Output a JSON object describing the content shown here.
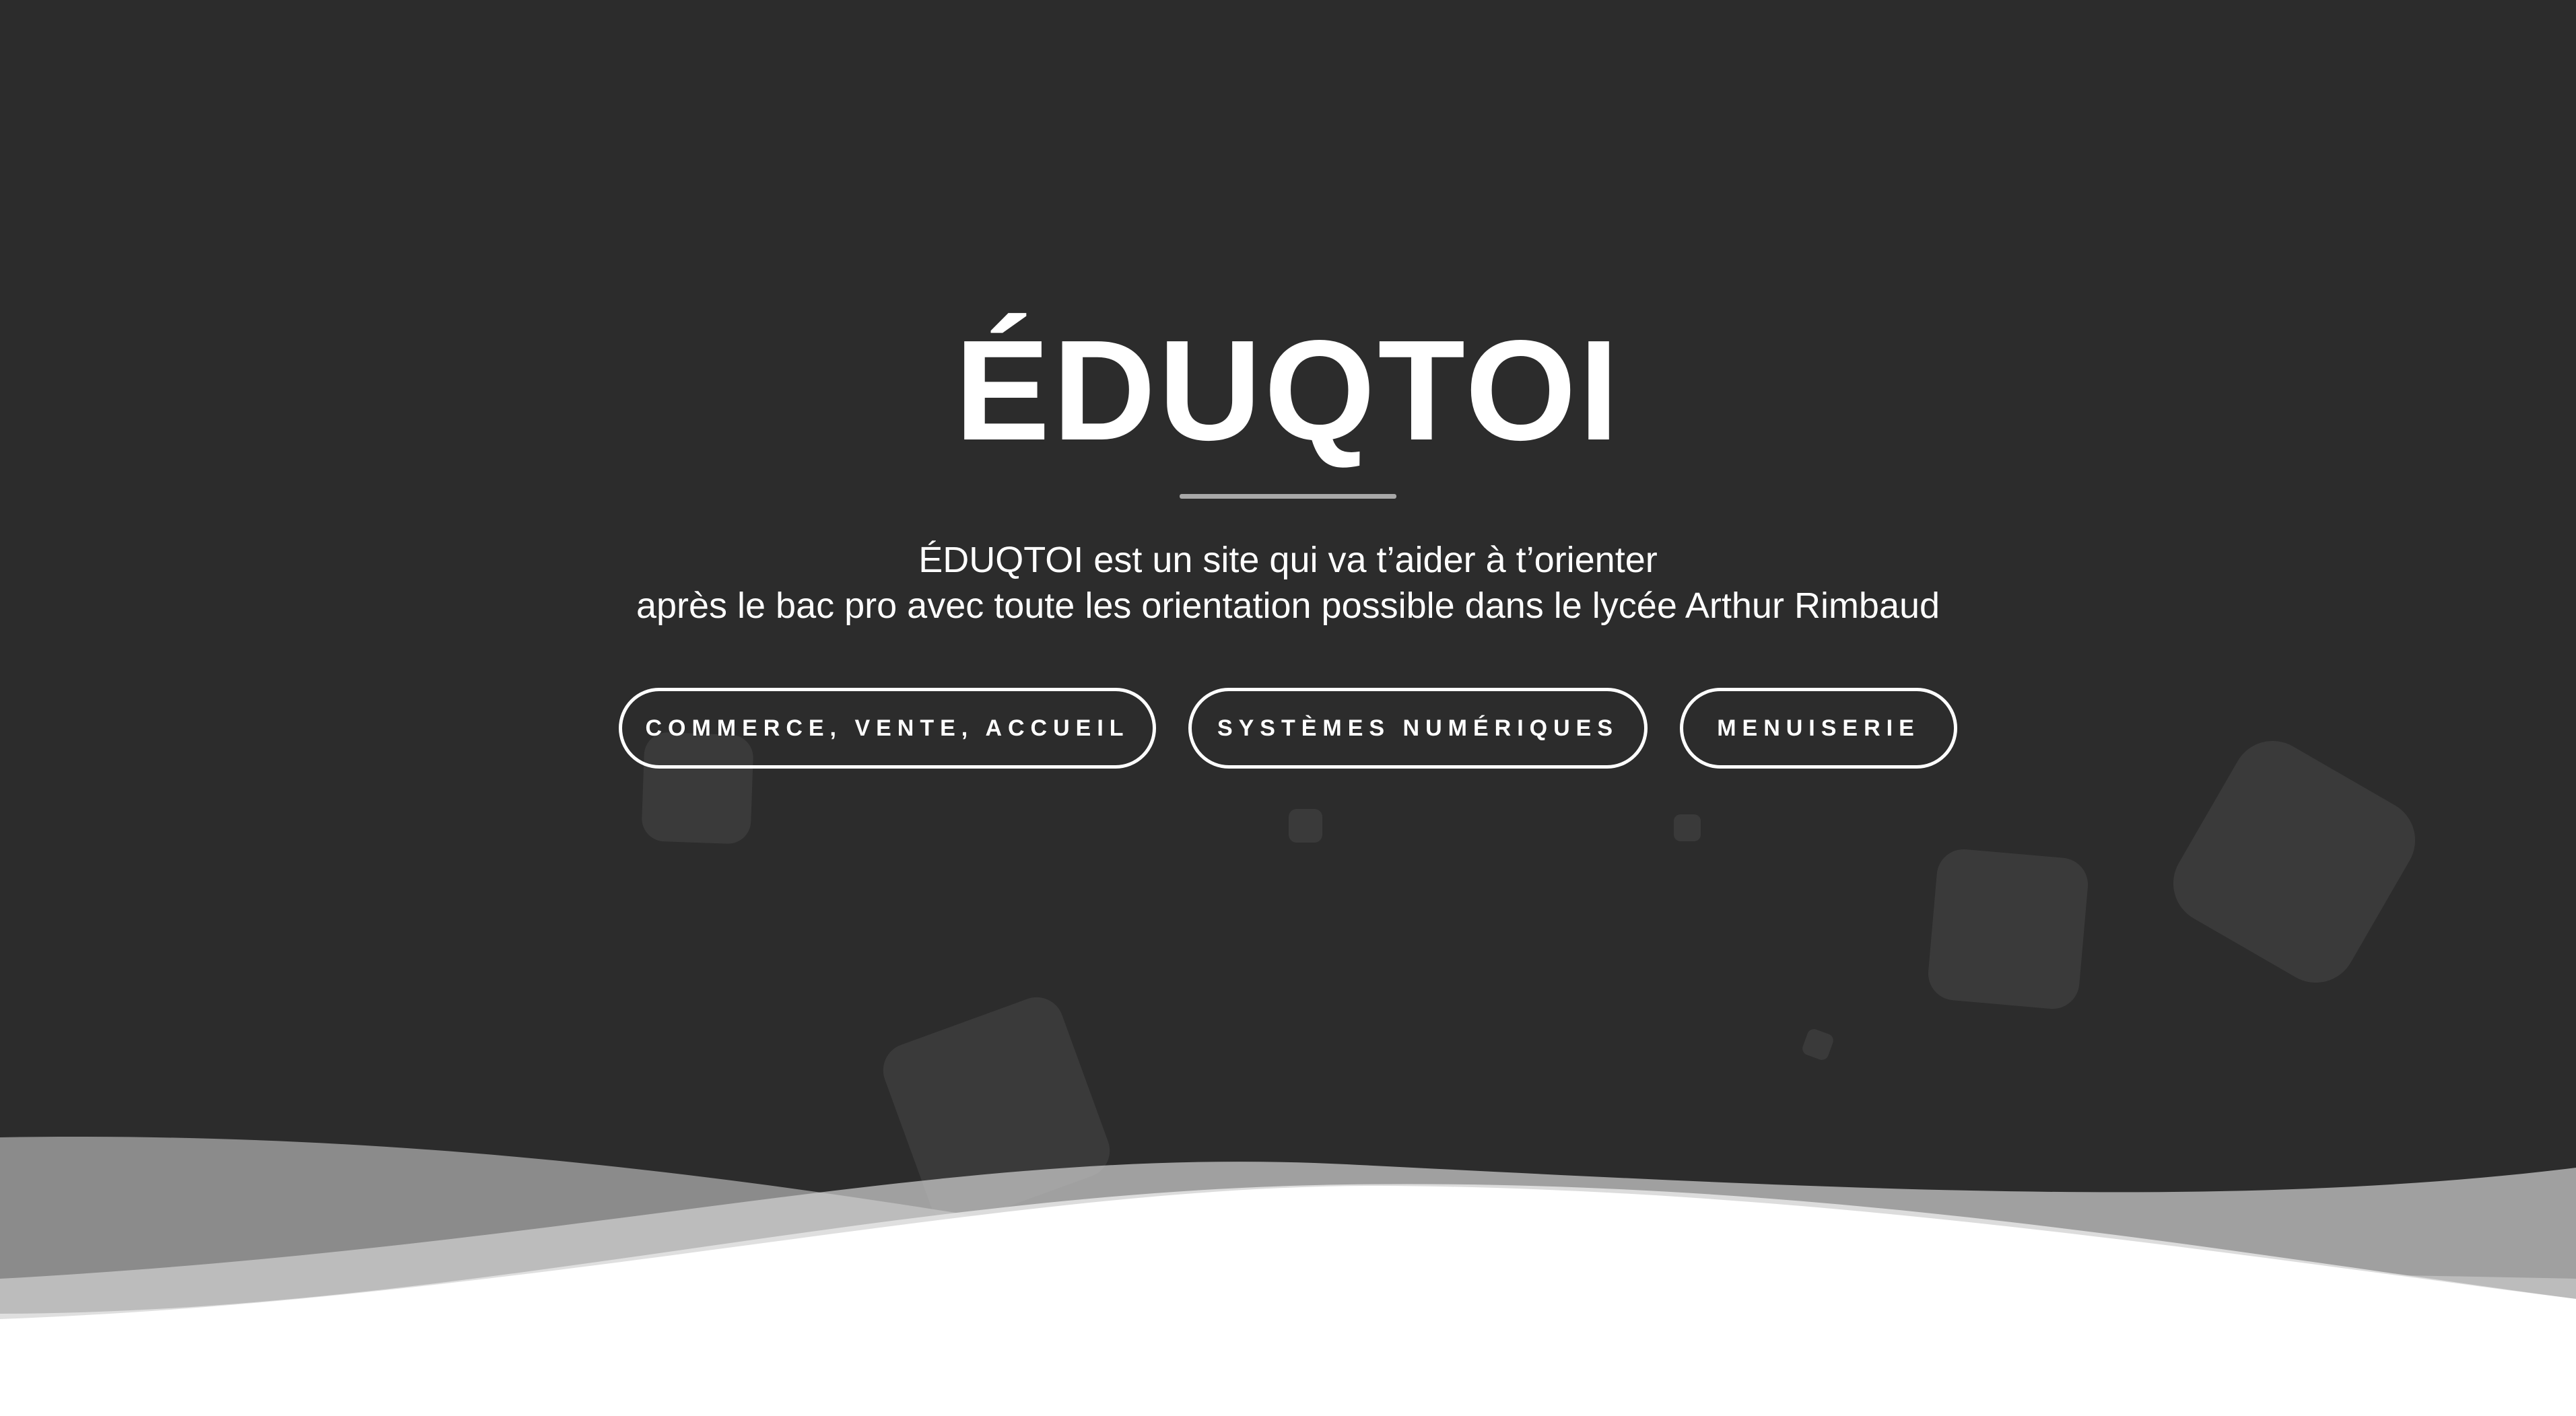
{
  "hero": {
    "title": "ÉDUQTOI",
    "subtitle_line1": "ÉDUQTOI est un site qui va t’aider à t’orienter",
    "subtitle_line2": "après le bac pro avec toute les orientation possible dans le lycée Arthur Rimbaud"
  },
  "nav": {
    "buttons": [
      {
        "label": "COMMERCE, VENTE, ACCUEIL"
      },
      {
        "label": "SYSTÈMES NUMÉRIQUES"
      },
      {
        "label": "MENUISERIE"
      }
    ]
  },
  "colors": {
    "background": "#2c2c2c",
    "text": "#ffffff",
    "divider": "#a9a9a9",
    "wave_light": "#d0d0d0",
    "wave_mid": "#9a9a9a",
    "wave_dark": "#6f6f6f"
  }
}
